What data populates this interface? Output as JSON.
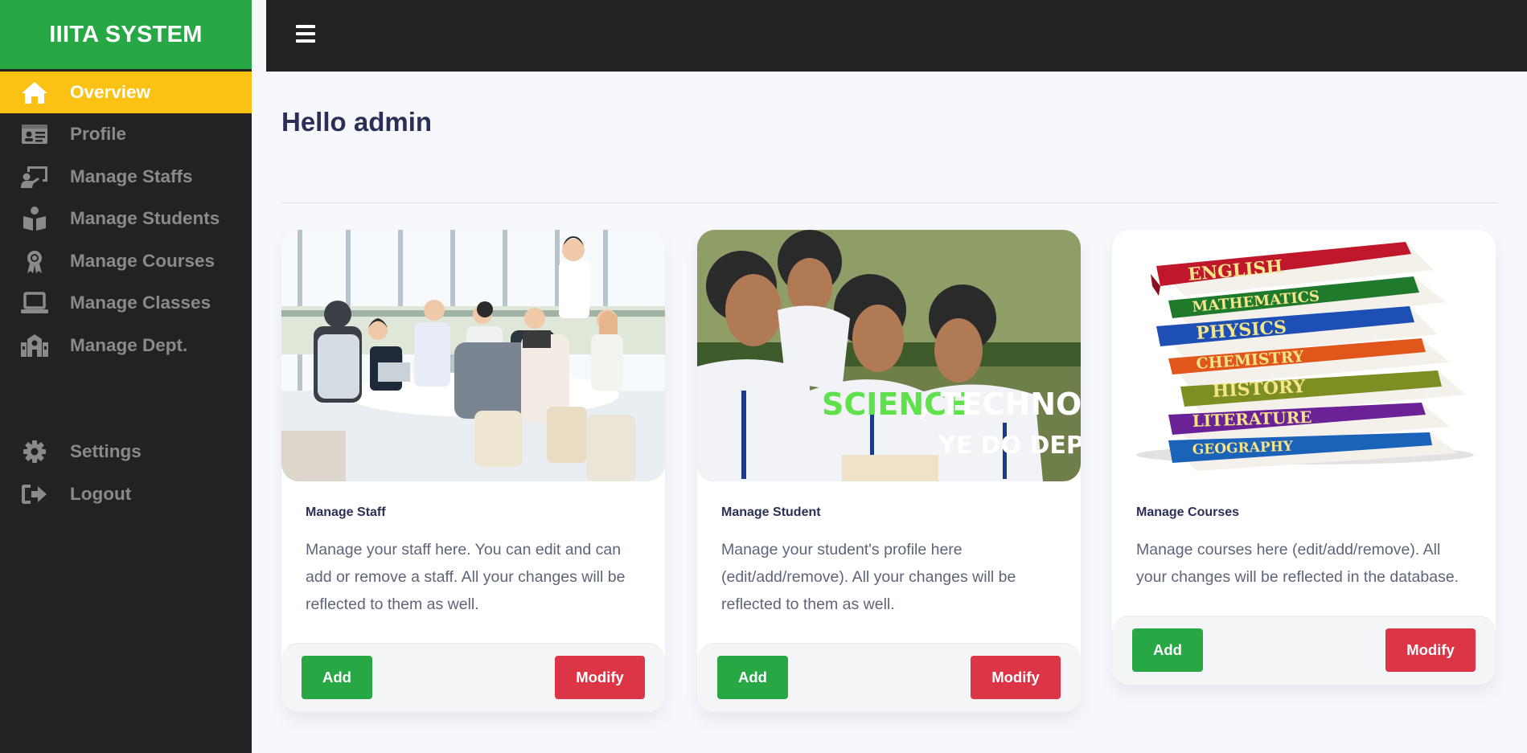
{
  "sidebar": {
    "brand": "IIITA SYSTEM",
    "items": [
      {
        "label": "Overview",
        "icon": "home-icon"
      },
      {
        "label": "Profile",
        "icon": "id-card-icon"
      },
      {
        "label": "Manage Staffs",
        "icon": "chalkboard-teacher-icon"
      },
      {
        "label": "Manage Students",
        "icon": "book-reader-icon"
      },
      {
        "label": "Manage Courses",
        "icon": "award-icon"
      },
      {
        "label": "Manage Classes",
        "icon": "laptop-icon"
      },
      {
        "label": "Manage Dept.",
        "icon": "school-icon"
      }
    ],
    "bottom_items": [
      {
        "label": "Settings",
        "icon": "gear-icon"
      },
      {
        "label": "Logout",
        "icon": "sign-out-icon"
      }
    ]
  },
  "topbar": {
    "menu_icon": "hamburger-menu-icon"
  },
  "main": {
    "title": "Hello admin",
    "cards": [
      {
        "title": "Manage Staff",
        "text": "Manage your staff here. You can edit and can add or remove a staff. All your changes will be reflected to them as well.",
        "add_label": "Add",
        "modify_label": "Modify"
      },
      {
        "title": "Manage Student",
        "text": "Manage your student's profile here (edit/add/remove). All your changes will be reflected to them as well.",
        "add_label": "Add",
        "modify_label": "Modify",
        "image_caption_1": "SCIENCE",
        "image_caption_2": ", TECHNOLOGY",
        "image_caption_3": "YE DO DEPLOY"
      },
      {
        "title": "Manage Courses",
        "text": "Manage courses here (edit/add/remove). All your changes will be reflected in the database.",
        "add_label": "Add",
        "modify_label": "Modify",
        "book_labels": [
          "ENGLISH",
          "MATHEMATICS",
          "PHYSICS",
          "CHEMISTRY",
          "HISTORY",
          "LITERATURE",
          "GEOGRAPHY"
        ]
      }
    ]
  },
  "colors": {
    "brand_green": "#28a745",
    "active_yellow": "#fbc113",
    "dark": "#222222",
    "danger": "#dc3545"
  }
}
